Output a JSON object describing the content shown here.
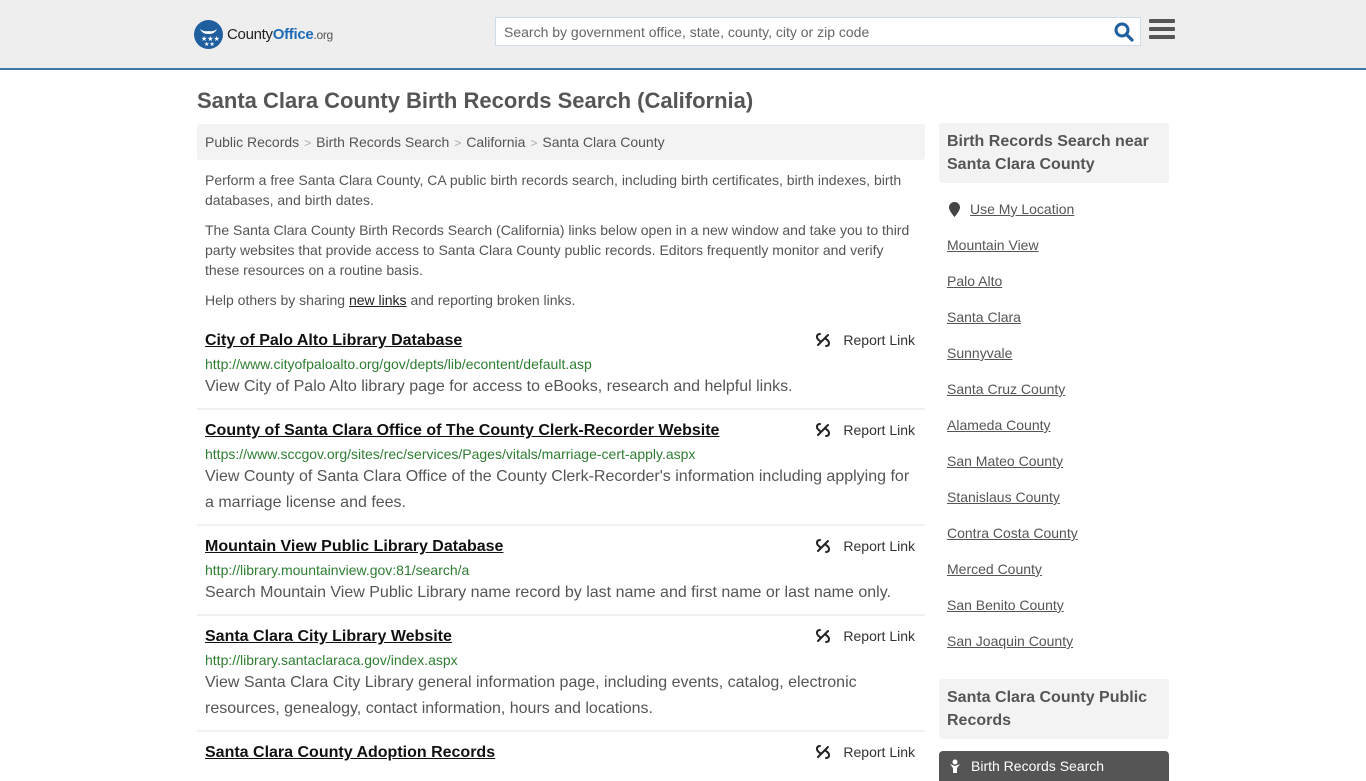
{
  "header": {
    "logo_part1": "County",
    "logo_part2": "Office",
    "logo_part3": ".org",
    "search_placeholder": "Search by government office, state, county, city or zip code",
    "search_value": "",
    "search_icon": "search-icon",
    "menu_icon": "hamburger-menu-icon",
    "accent_color": "#3b7aa8"
  },
  "page": {
    "title": "Santa Clara County Birth Records Search (California)"
  },
  "breadcrumb": [
    {
      "label": "Public Records"
    },
    {
      "label": "Birth Records Search"
    },
    {
      "label": "California"
    },
    {
      "label": "Santa Clara County"
    }
  ],
  "intro": {
    "p1": "Perform a free Santa Clara County, CA public birth records search, including birth certificates, birth indexes, birth databases, and birth dates.",
    "p2": "The Santa Clara County Birth Records Search (California) links below open in a new window and take you to third party websites that provide access to Santa Clara County public records. Editors frequently monitor and verify these resources on a routine basis.",
    "p3_before": "Help others by sharing ",
    "p3_link": "new links",
    "p3_after": " and reporting broken links."
  },
  "report_label": "Report Link",
  "listings": [
    {
      "title": "City of Palo Alto Library Database",
      "url": "http://www.cityofpaloalto.org/gov/depts/lib/econtent/default.asp",
      "desc": "View City of Palo Alto library page for access to eBooks, research and helpful links."
    },
    {
      "title": "County of Santa Clara Office of The County Clerk-Recorder Website",
      "url": "https://www.sccgov.org/sites/rec/services/Pages/vitals/marriage-cert-apply.aspx",
      "desc": "View County of Santa Clara Office of the County Clerk-Recorder's information including applying for a marriage license and fees."
    },
    {
      "title": "Mountain View Public Library Database",
      "url": "http://library.mountainview.gov:81/search/a",
      "desc": "Search Mountain View Public Library name record by last name and first name or last name only."
    },
    {
      "title": "Santa Clara City Library Website",
      "url": "http://library.santaclaraca.gov/index.aspx",
      "desc": "View Santa Clara City Library general information page, including events, catalog, electronic resources, genealogy, contact information, hours and locations."
    },
    {
      "title": "Santa Clara County Adoption Records",
      "url": "",
      "desc": ""
    }
  ],
  "sidebar": {
    "nearby_heading": "Birth Records Search near Santa Clara County",
    "use_location": "Use My Location",
    "nearby": [
      "Mountain View",
      "Palo Alto",
      "Santa Clara",
      "Sunnyvale",
      "Santa Cruz County",
      "Alameda County",
      "San Mateo County",
      "Stanislaus County",
      "Contra Costa County",
      "Merced County",
      "San Benito County",
      "San Joaquin County"
    ],
    "public_records_heading": "Santa Clara County Public Records",
    "active_item": "Birth Records Search"
  }
}
